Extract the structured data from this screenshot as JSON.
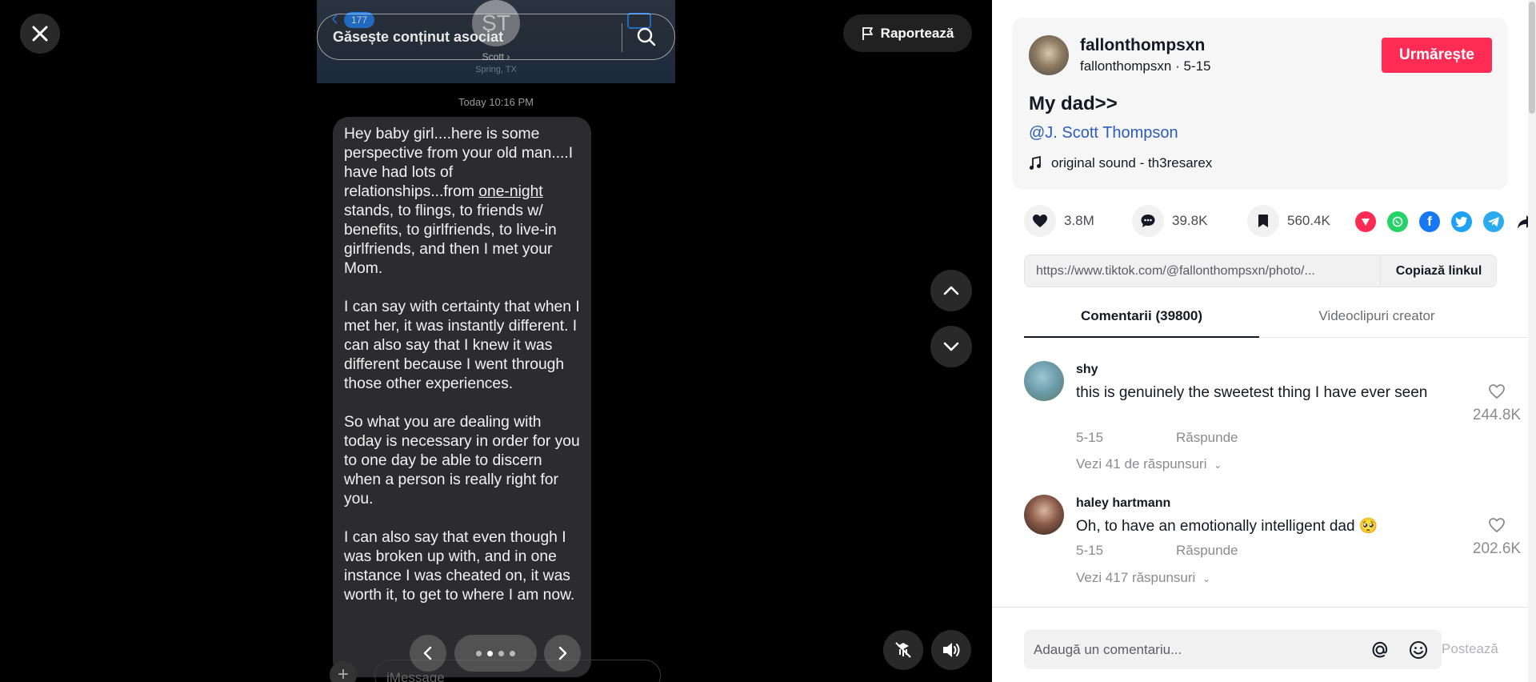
{
  "viewer": {
    "report_label": "Raportează",
    "search": {
      "placeholder_text": "Găsește conținut asociat"
    },
    "phone": {
      "back_badge": "177",
      "contact_initials": "ST",
      "contact_name": "Scott ›",
      "contact_location": "Spring, TX",
      "timestamp": "Today 10:16 PM",
      "message_paragraphs": [
        {
          "before": "Hey baby girl....here is some perspective from your old man....I have had lots of relationships...from ",
          "underlined": "one-night",
          "after": " stands, to flings, to friends w/ benefits, to girlfriends, to live-in girlfriends, and then I met your Mom."
        },
        {
          "before": "I can say with certainty that when I met her, it was instantly different. I can also say that I knew it was different because I went through those other experiences.",
          "underlined": "",
          "after": ""
        },
        {
          "before": "So what you are dealing with today is necessary in order for you to one day be able to discern when a person is really right for you.",
          "underlined": "",
          "after": ""
        },
        {
          "before": "I can also say that even though I was broken up with, and in one instance I was cheated on, it was worth it, to get to where I am now.",
          "underlined": "",
          "after": ""
        }
      ],
      "imessage_placeholder": "iMessage"
    },
    "carousel": {
      "total": 4,
      "active_index": 1
    }
  },
  "panel": {
    "creator": {
      "username": "fallonthompsxn",
      "subline": "fallonthompsxn · 5-15",
      "follow_label": "Urmărește"
    },
    "caption": "My dad>>",
    "mention": "@J.  Scott  Thompson",
    "music": "original sound - th3resarex",
    "stats": {
      "likes": "3.8M",
      "comments": "39.8K",
      "saves": "560.4K"
    },
    "share_icons": [
      "pin-icon",
      "whatsapp-icon",
      "facebook-icon",
      "twitter-icon",
      "telegram-icon",
      "forward-icon"
    ],
    "colors": {
      "accent": "#fe2c55",
      "link": "#2b5db9"
    },
    "link": {
      "url": "https://www.tiktok.com/@fallonthompsxn/photo/...",
      "copy_label": "Copiază linkul"
    },
    "tabs": [
      {
        "label": "Comentarii (39800)",
        "active": true
      },
      {
        "label": "Videoclipuri creator",
        "active": false
      }
    ],
    "comments": [
      {
        "user": "shy",
        "text": "this is genuinely the sweetest thing I have ever seen",
        "date": "5-15",
        "reply_label": "Răspunde",
        "view_replies": "Vezi 41 de răspunsuri",
        "likes": "244.8K"
      },
      {
        "user": "haley hartmann",
        "text": "Oh, to have an emotionally intelligent dad 🥺",
        "date": "5-15",
        "reply_label": "Răspunde",
        "view_replies": "Vezi 417 răspunsuri",
        "likes": "202.6K"
      }
    ],
    "comment_input": {
      "placeholder": "Adaugă un comentariu...",
      "post_label": "Postează"
    }
  }
}
